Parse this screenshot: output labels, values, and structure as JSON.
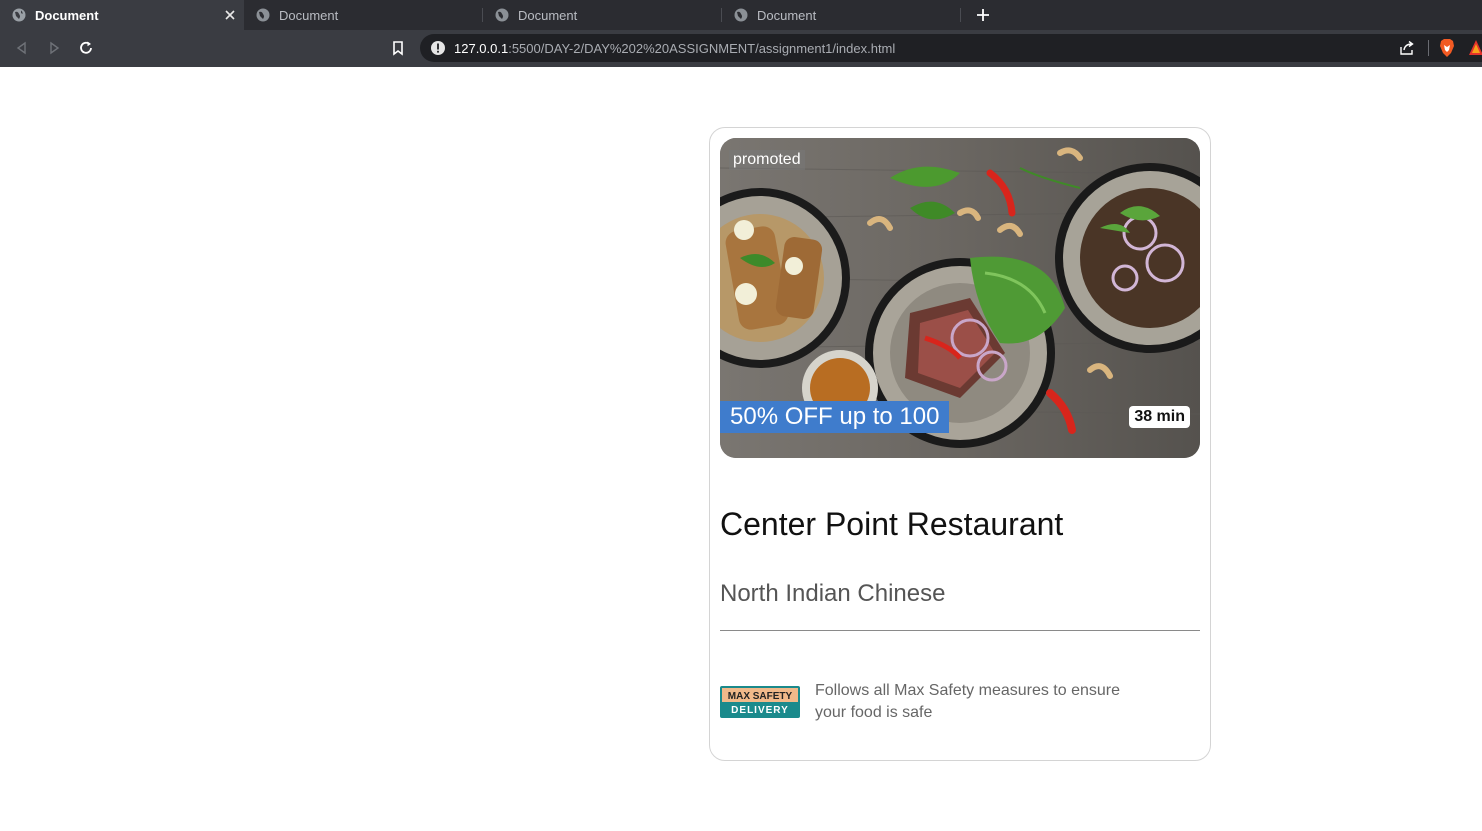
{
  "browser": {
    "tabs": [
      {
        "label": "Document",
        "active": true
      },
      {
        "label": "Document",
        "active": false
      },
      {
        "label": "Document",
        "active": false
      },
      {
        "label": "Document",
        "active": false
      }
    ],
    "url_host": "127.0.0.1",
    "url_path": ":5500/DAY-2/DAY%202%20ASSIGNMENT/assignment1/index.html"
  },
  "card": {
    "tag": "promoted",
    "offer": "50% OFF up to 100",
    "eta": "38 min",
    "name": "Center Point Restaurant",
    "cuisine": "North Indian Chinese",
    "badge_top": "MAX SAFETY",
    "badge_bottom": "DELIVERY",
    "safety_text": "Follows all Max Safety measures to ensure your food is safe"
  },
  "colors": {
    "offer_bg": "#3f7ccc",
    "badge_bg": "#1a8a8c",
    "badge_top_bg": "#f1b98a"
  }
}
